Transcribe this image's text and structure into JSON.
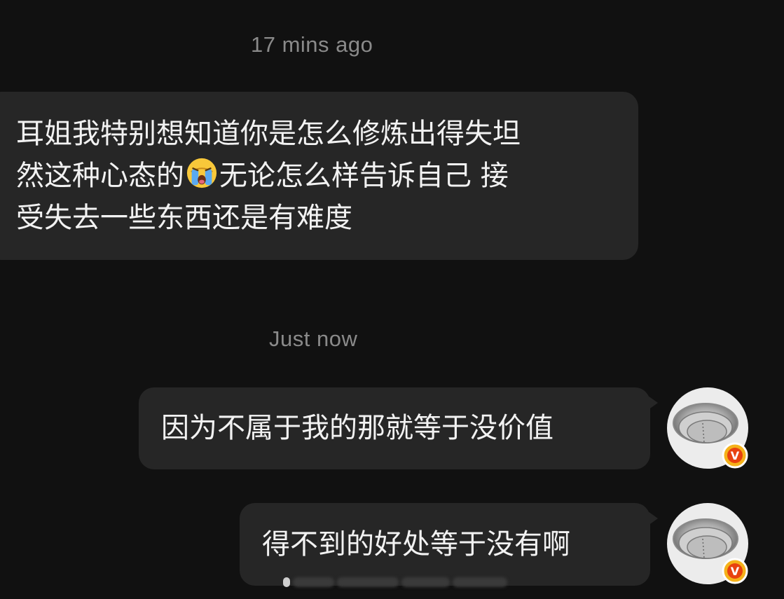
{
  "conversation": {
    "timestamps": [
      "17 mins ago",
      "Just now"
    ],
    "incoming": {
      "line1": "耳姐我特别想知道你是怎么修炼出得失坦",
      "line2_a": "然这种心态的",
      "emoji": "loudly-crying-face",
      "line2_b": "无论怎么样告诉自己 接",
      "line3": "受失去一些东西还是有难度"
    },
    "outgoing": [
      {
        "text": "因为不属于我的那就等于没价值"
      },
      {
        "text": "得不到的好处等于没有啊"
      }
    ],
    "avatar_badge": "V"
  },
  "colors": {
    "background": "#111111",
    "bubble": "#262626",
    "text": "#f2f2f2",
    "timestamp": "#8a8a8a",
    "badge": "#f5b21a",
    "badge_inner": "#e8420f"
  }
}
